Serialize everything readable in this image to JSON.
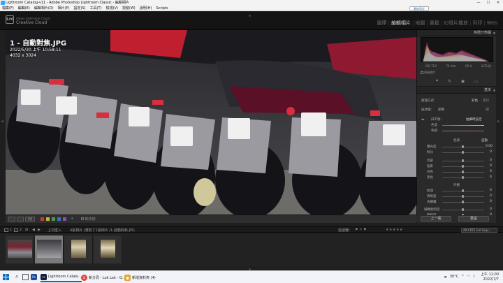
{
  "window": {
    "title": "Lightroom Catalog-v11 - Adobe Photoshop Lightroom Classic - 編輯相片",
    "controls": [
      "—",
      "☐",
      "✕"
    ]
  },
  "menu": {
    "items": [
      "檔案(F)",
      "編輯(E)",
      "編輯相片(D)",
      "相片(P)",
      "設定(S)",
      "工具(T)",
      "檢視(V)",
      "視窗(W)",
      "說明(H)",
      "Scripts"
    ],
    "sync_label": "開始同步"
  },
  "identity": {
    "badge": "Lrc",
    "brand_top": "Adobe Lightroom Classic",
    "brand_bottom": "Creative Cloud",
    "modules": [
      "圖庫",
      "編輯相片",
      "地圖",
      "書籍",
      "幻燈片播放",
      "列印",
      "Web"
    ],
    "active_module_index": 1
  },
  "photo": {
    "filename": "1 - 自動對焦.JPG",
    "datetime": "2022/5/30  上午 10:58:11",
    "dimensions": "4032 x 3024",
    "plates": [
      "MP 7-01",
      "NS 7-74",
      "ME 5-28",
      "MOT 2-57",
      "5-42"
    ]
  },
  "toolbar": {
    "softproof_label": "軟校樣",
    "flag_colors": [
      "#c63c3c",
      "#c8b13a",
      "#4c9a4c",
      "#3f6fc0",
      "#8a4fb0"
    ]
  },
  "right_panel": {
    "histogram_title": "色階分佈圖",
    "histogram_readout": [
      "ISO 713",
      "72 mm",
      "f/2.4",
      "1/73 秒"
    ],
    "original_photo_label": "原始相片",
    "basic_title": "基本",
    "treatment_label": "處理方式：",
    "treatment_options": [
      "彩色",
      "黑白"
    ],
    "profile_label": "描述檔：",
    "profile_value": "彩色",
    "wb_label": "白平衡：",
    "wb_value": "拍攝時設定",
    "temp_label": "色溫",
    "tint_label": "色調",
    "tone_title": "色調",
    "tone_auto": "自動",
    "exposure_label": "曝光度",
    "exposure_value": "0.00",
    "contrast_label": "對比",
    "highlights_label": "亮部",
    "shadows_label": "陰影",
    "whites_label": "白色",
    "blacks_label": "黑色",
    "presence_title": "外觀",
    "texture_label": "紋理",
    "clarity_label": "清晰度",
    "dehaze_label": "去朦朧",
    "vibrance_label": "細緻飽和度",
    "saturation_label": "飽和度",
    "zero": "0",
    "prev_button": "上一張",
    "reset_button": "重設"
  },
  "filmstrip_bar": {
    "page_labels": [
      "1",
      "2"
    ],
    "import_label": "上次匯入",
    "count_text": "4張相片 /選取了1張相片 /1-自動對焦.JPG",
    "filter_label": "過濾器：",
    "stars": "★★★★★",
    "filter_dropdown": "AR-CRTS Full Sequ..."
  },
  "taskbar": {
    "apps": [
      {
        "label": "Lightroom Catalo...",
        "color": "#0f1e3a",
        "badge": "Lr",
        "active": true
      },
      {
        "label": "新分頁 - Lok Lok - G...",
        "color": "#d94a38",
        "badge": "G",
        "active": false
      },
      {
        "label": "新增資料夾 (4)",
        "color": "#e2a72c",
        "badge": "▆",
        "active": false
      }
    ],
    "weather": "30°C",
    "time": "上午 11:00",
    "date": "2022/7/7"
  }
}
